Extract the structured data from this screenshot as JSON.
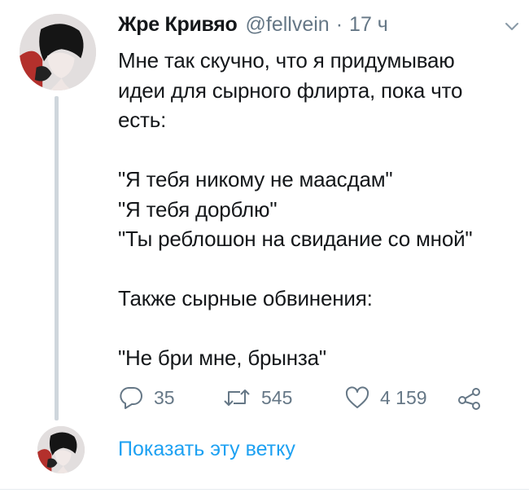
{
  "tweet": {
    "author_name": "Жре Кривяо",
    "author_handle": "@fellvein",
    "separator": "·",
    "timestamp": "17 ч",
    "text": "Мне так скучно, что я придумываю\nидеи для сырного флирта, пока что\nесть:\n\n\"Я тебя никому не маасдам\"\n\"Я тебя дорблю\"\n\"Ты реблошон на свидание со мной\"\n\nТакже сырные обвинения:\n\n\"Не бри мне, брынза\"",
    "actions": {
      "replies": "35",
      "retweets": "545",
      "likes": "4 159"
    }
  },
  "thread": {
    "show_label": "Показать эту ветку"
  },
  "icons": {
    "reply": "reply-icon",
    "retweet": "retweet-icon",
    "like": "heart-icon",
    "share": "share-icon",
    "menu": "chevron-down-icon"
  },
  "colors": {
    "text": "#14171a",
    "muted": "#657786",
    "link": "#1da1f2",
    "thread_line": "#cfd6dc"
  }
}
